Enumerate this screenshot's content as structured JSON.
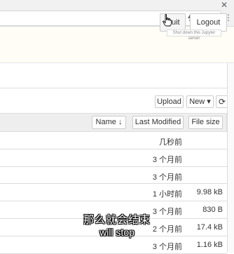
{
  "browser": {
    "icons": [
      "zoom-icon",
      "lightning-icon",
      "star-icon",
      "dropdown-icon",
      "extension-icon"
    ],
    "close_glyph": "✕",
    "menu_glyph": "⋮"
  },
  "header": {
    "quit_label": "Quit",
    "logout_label": "Logout",
    "quit_tooltip": "Shut down this Jupyter server"
  },
  "toolbar": {
    "upload_label": "Upload",
    "new_label": "New ▾",
    "refresh_glyph": "⟳"
  },
  "list_header": {
    "name_label": "Name ↓",
    "last_modified_label": "Last Modified",
    "file_size_label": "File size"
  },
  "files": [
    {
      "modified": "几秒前",
      "size": ""
    },
    {
      "modified": "3 个月前",
      "size": ""
    },
    {
      "modified": "3 个月前",
      "size": ""
    },
    {
      "modified": "1 小时前",
      "size": "9.98 kB"
    },
    {
      "modified": "3 个月前",
      "size": "830 B"
    },
    {
      "modified": "2 个月前",
      "size": "17.4 kB"
    },
    {
      "modified": "3 个月前",
      "size": "1.16 kB"
    }
  ],
  "subtitle": {
    "zh": "那么就会结束",
    "en": "will stop"
  }
}
